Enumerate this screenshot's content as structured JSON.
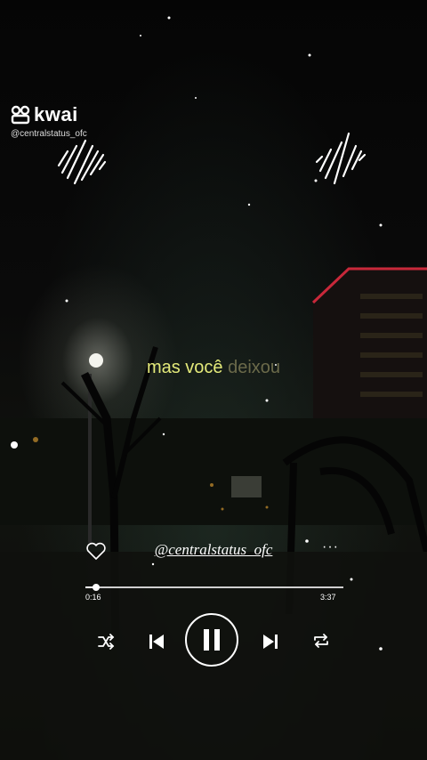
{
  "app": {
    "logo_text": "kwai",
    "handle": "@centralstatus_ofc"
  },
  "lyric": {
    "highlighted": "mas você",
    "upcoming": "deixou"
  },
  "player": {
    "author": "@centralstatus_ofc",
    "more_label": "···",
    "elapsed": "0:16",
    "duration": "3:37",
    "progress": 0.04
  },
  "icons": [
    "kwai-logo-icon",
    "sound-wave-icon",
    "heart-icon",
    "more-icon",
    "shuffle-icon",
    "previous-icon",
    "pause-icon",
    "next-icon",
    "repeat-icon"
  ],
  "colors": {
    "lyric_active": "#e4ea7a",
    "lyric_inactive": "#6b6a4a",
    "controls": "#ffffff"
  }
}
